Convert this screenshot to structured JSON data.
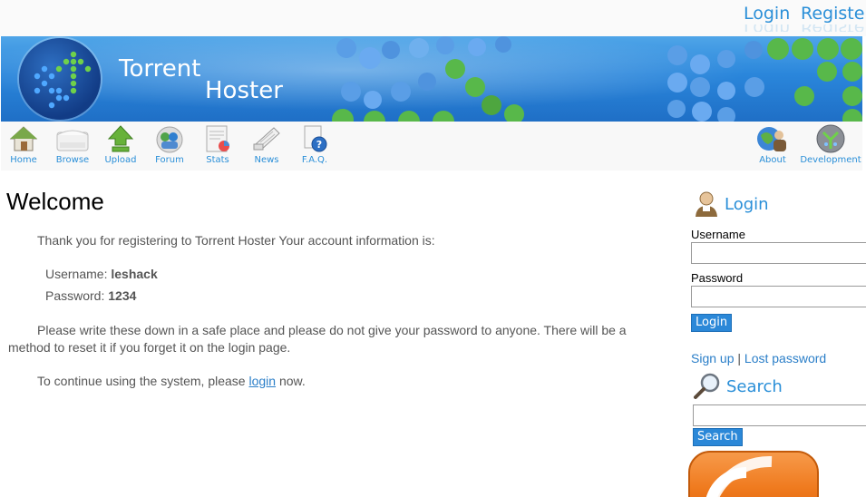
{
  "top_links": {
    "login": "Login",
    "register": "Register"
  },
  "brand": {
    "line1": "Torrent",
    "line2": "Hoster"
  },
  "nav": {
    "home": "Home",
    "browse": "Browse",
    "upload": "Upload",
    "forum": "Forum",
    "stats": "Stats",
    "news": "News",
    "faq": "F.A.Q.",
    "about": "About",
    "development": "Development"
  },
  "main": {
    "title": "Welcome",
    "intro": "Thank you for registering to Torrent Hoster Your account information is:",
    "username_label": "Username:",
    "username_value": "leshack",
    "password_label": "Password:",
    "password_value": "1234",
    "advice": "Please write these down in a safe place and please do not give your password to anyone. There will be a method to reset it if you forget it on the login page.",
    "continue_prefix": "To continue using the system, please",
    "continue_link": "login",
    "continue_suffix": "now."
  },
  "sidebar": {
    "login_heading": "Login",
    "username_label": "Username",
    "username_value": "",
    "password_label": "Password",
    "password_value": "",
    "login_button": "Login",
    "signup_link": "Sign up",
    "separator": "|",
    "lost_password_link": "Lost password",
    "search_heading": "Search",
    "search_value": "",
    "search_button": "Search"
  },
  "colors": {
    "accent": "#2a8fd8",
    "banner_blue": "#2a86db",
    "logo_green": "#4ec23a",
    "rss_orange": "#ef7a1e"
  },
  "icons": [
    "home-icon",
    "browse-icon",
    "upload-icon",
    "forum-icon",
    "stats-icon",
    "news-icon",
    "faq-icon",
    "about-icon",
    "development-icon",
    "user-icon",
    "magnifier-icon",
    "rss-icon"
  ]
}
